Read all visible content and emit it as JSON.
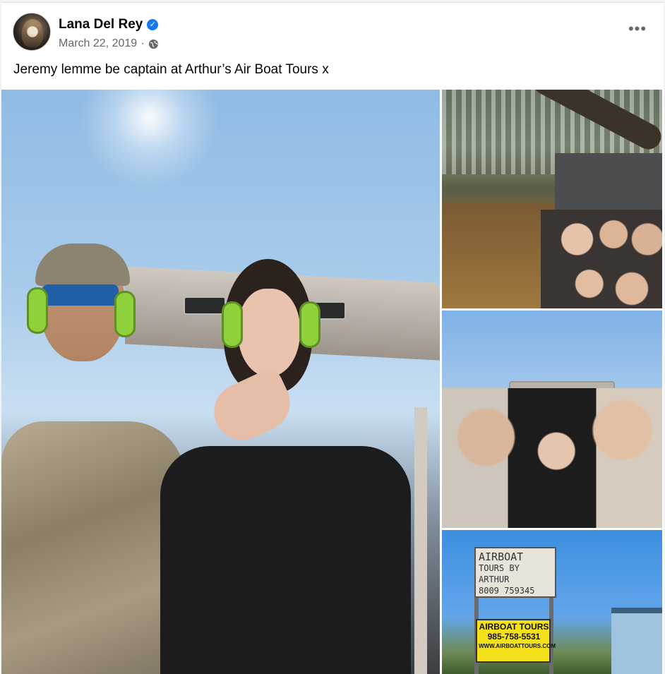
{
  "post": {
    "author": "Lana Del Rey",
    "date": "March 22, 2019",
    "separator": "·",
    "caption": "Jeremy lemme be captain at Arthur’s Air Boat Tours x",
    "more_label": "•••",
    "icons": [
      "verified-badge-icon",
      "globe-icon",
      "more-options-icon"
    ]
  },
  "photos": [
    {
      "name": "main-photo",
      "alt": "Selfie on airboat"
    },
    {
      "name": "swamp-photo",
      "alt": "Airboat in swamp"
    },
    {
      "name": "group-photo",
      "alt": "Group selfie"
    },
    {
      "name": "sign-photo",
      "alt": "Airboat tours sign"
    }
  ],
  "sign": {
    "board_lines": [
      "AIRBOAT",
      "TOURS BY ARTHUR",
      "8009 759345"
    ],
    "yellow_lines": [
      "AIRBOAT TOURS",
      "985-758-5531",
      "WWW.AIRBOATTOURS.COM"
    ]
  },
  "colors": {
    "verified": "#1877f2",
    "text_primary": "#050505",
    "text_secondary": "#65676b"
  }
}
